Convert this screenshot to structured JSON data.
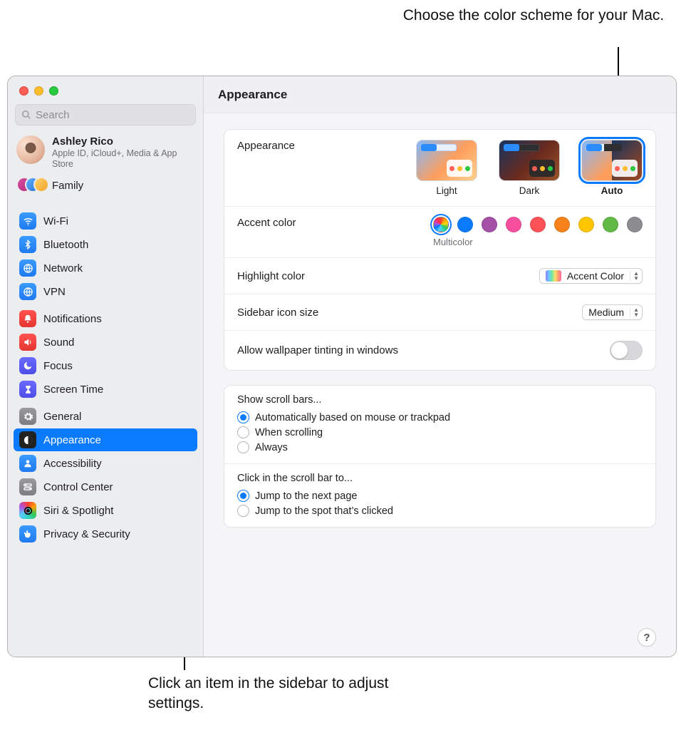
{
  "callouts": {
    "top": "Choose the color scheme for your Mac.",
    "bottom": "Click an item in the sidebar to adjust settings."
  },
  "search": {
    "placeholder": "Search"
  },
  "account": {
    "name": "Ashley Rico",
    "sub": "Apple ID, iCloud+, Media & App Store",
    "family": "Family"
  },
  "sidebar": {
    "groups": [
      {
        "items": [
          {
            "id": "wifi",
            "label": "Wi-Fi",
            "color": "ic-blue",
            "glyph": "wifi"
          },
          {
            "id": "bluetooth",
            "label": "Bluetooth",
            "color": "ic-blue",
            "glyph": "bluetooth"
          },
          {
            "id": "network",
            "label": "Network",
            "color": "ic-blue",
            "glyph": "globe"
          },
          {
            "id": "vpn",
            "label": "VPN",
            "color": "ic-blue",
            "glyph": "globe"
          }
        ]
      },
      {
        "items": [
          {
            "id": "notifications",
            "label": "Notifications",
            "color": "ic-red",
            "glyph": "bell"
          },
          {
            "id": "sound",
            "label": "Sound",
            "color": "ic-red",
            "glyph": "speaker"
          },
          {
            "id": "focus",
            "label": "Focus",
            "color": "ic-indigo",
            "glyph": "moon"
          },
          {
            "id": "screentime",
            "label": "Screen Time",
            "color": "ic-indigo",
            "glyph": "hourglass"
          }
        ]
      },
      {
        "items": [
          {
            "id": "general",
            "label": "General",
            "color": "ic-gray",
            "glyph": "gear"
          },
          {
            "id": "appearance",
            "label": "Appearance",
            "color": "ic-black",
            "glyph": "appearance",
            "selected": true
          },
          {
            "id": "accessibility",
            "label": "Accessibility",
            "color": "ic-blue",
            "glyph": "person"
          },
          {
            "id": "controlcenter",
            "label": "Control Center",
            "color": "ic-gray",
            "glyph": "switches"
          },
          {
            "id": "siri",
            "label": "Siri & Spotlight",
            "color": "ic-siri",
            "glyph": "siri"
          },
          {
            "id": "privacy",
            "label": "Privacy & Security",
            "color": "ic-privacy",
            "glyph": "hand"
          }
        ]
      }
    ]
  },
  "header": {
    "title": "Appearance"
  },
  "appearance": {
    "label": "Appearance",
    "options": [
      {
        "id": "light",
        "label": "Light"
      },
      {
        "id": "dark",
        "label": "Dark"
      },
      {
        "id": "auto",
        "label": "Auto",
        "selected": true
      }
    ]
  },
  "accent": {
    "label": "Accent color",
    "selected": "multicolor",
    "selected_label": "Multicolor",
    "options": [
      {
        "id": "multicolor",
        "hex": "multi"
      },
      {
        "id": "blue",
        "hex": "#0a7bff"
      },
      {
        "id": "purple",
        "hex": "#a550a7"
      },
      {
        "id": "pink",
        "hex": "#f74f9e"
      },
      {
        "id": "red",
        "hex": "#ff5257"
      },
      {
        "id": "orange",
        "hex": "#f7821b"
      },
      {
        "id": "yellow",
        "hex": "#ffc600"
      },
      {
        "id": "green",
        "hex": "#62ba46"
      },
      {
        "id": "graphite",
        "hex": "#8c8c91"
      }
    ]
  },
  "highlight": {
    "label": "Highlight color",
    "value": "Accent Color"
  },
  "sidebar_icon": {
    "label": "Sidebar icon size",
    "value": "Medium"
  },
  "wallpaper_tint": {
    "label": "Allow wallpaper tinting in windows",
    "on": false
  },
  "scrollbars": {
    "title": "Show scroll bars...",
    "options": [
      {
        "id": "auto",
        "label": "Automatically based on mouse or trackpad",
        "selected": true
      },
      {
        "id": "scrolling",
        "label": "When scrolling"
      },
      {
        "id": "always",
        "label": "Always"
      }
    ]
  },
  "scrollclick": {
    "title": "Click in the scroll bar to...",
    "options": [
      {
        "id": "page",
        "label": "Jump to the next page",
        "selected": true
      },
      {
        "id": "spot",
        "label": "Jump to the spot that’s clicked"
      }
    ]
  },
  "help": {
    "label": "?"
  }
}
